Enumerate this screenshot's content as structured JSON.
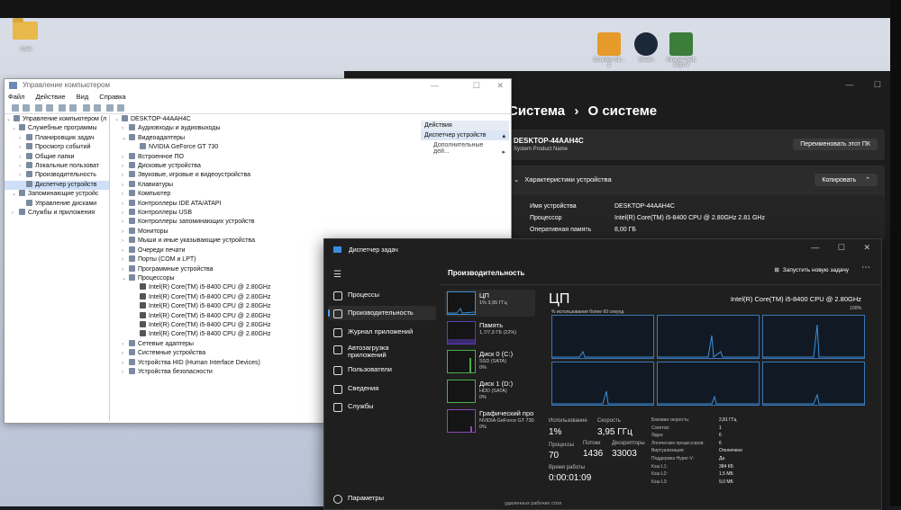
{
  "desktop": {
    "icons": [
      {
        "label": "User",
        "icon": "folder-icon"
      },
      {
        "label": "Counter-Str... 2",
        "icon": "cs2-icon"
      },
      {
        "label": "Steam",
        "icon": "steam-icon"
      },
      {
        "label": "Grand Theft Auto V",
        "icon": "gta5-icon"
      }
    ]
  },
  "devmgr": {
    "title": "Управление компьютером",
    "menu": [
      "Файл",
      "Действие",
      "Вид",
      "Справка"
    ],
    "left_tree": [
      "Управление компьютером (л",
      "Служебные программы",
      "Планировщик задач",
      "Просмотр событий",
      "Общие папки",
      "Локальные пользоват",
      "Производительность",
      "Диспетчер устройств",
      "Запоминающие устройс",
      "Управление дисками",
      "Службы и приложения"
    ],
    "device_tree": [
      "DESKTOP-44AAH4C",
      "Аудиовходы и аудиовыходы",
      "Видеоадаптеры",
      "NVIDIA GeForce GT 730",
      "Встроенное ПО",
      "Дисковые устройства",
      "Звуковые, игровые и видеоустройства",
      "Клавиатуры",
      "Компьютер",
      "Контроллеры IDE ATA/ATAPI",
      "Контроллеры USB",
      "Контроллеры запоминающих устройств",
      "Мониторы",
      "Мыши и иные указывающие устройства",
      "Очереди печати",
      "Порты (COM и LPT)",
      "Программные устройства",
      "Процессоры",
      "Intel(R) Core(TM) i5-8400 CPU @ 2.80GHz",
      "Intel(R) Core(TM) i5-8400 CPU @ 2.80GHz",
      "Intel(R) Core(TM) i5-8400 CPU @ 2.80GHz",
      "Intel(R) Core(TM) i5-8400 CPU @ 2.80GHz",
      "Intel(R) Core(TM) i5-8400 CPU @ 2.80GHz",
      "Intel(R) Core(TM) i5-8400 CPU @ 2.80GHz",
      "Сетевые адаптеры",
      "Системные устройства",
      "Устройства HID (Human Interface Devices)",
      "Устройства безопасности"
    ],
    "actions": {
      "header": "Действия",
      "selected": "Диспетчер устройств",
      "more": "Дополнительные дей..."
    }
  },
  "settings": {
    "breadcrumb_parent": "Система",
    "breadcrumb_sep": "›",
    "breadcrumb_current": "О системе",
    "device_name": "DESKTOP-44AAH4C",
    "product": "System Product Name",
    "rename_button": "Переименовать этот ПК",
    "specs_title": "Характеристики устройства",
    "copy_button": "Копировать",
    "spec_rows": [
      {
        "label": "Имя устройства",
        "value": "DESKTOP-44AAH4C"
      },
      {
        "label": "Процессор",
        "value": "Intel(R) Core(TM) i5-8400 CPU @ 2.80GHz   2.81 GHz"
      },
      {
        "label": "Оперативная память",
        "value": "8,00 ГБ"
      }
    ]
  },
  "taskmgr": {
    "title": "Диспетчер задач",
    "nav": [
      {
        "label": "Процессы",
        "icon": "processes-icon"
      },
      {
        "label": "Производительность",
        "icon": "performance-icon"
      },
      {
        "label": "Журнал приложений",
        "icon": "app-history-icon"
      },
      {
        "label": "Автозагрузка приложений",
        "icon": "startup-icon"
      },
      {
        "label": "Пользователи",
        "icon": "users-icon"
      },
      {
        "label": "Сведения",
        "icon": "details-icon"
      },
      {
        "label": "Службы",
        "icon": "services-icon"
      }
    ],
    "settings_label": "Параметры",
    "section_title": "Производительность",
    "run_task": "Запустить новую задачу",
    "devices": [
      {
        "name": "ЦП",
        "sub": "1% 3,95 ГГц"
      },
      {
        "name": "Память",
        "sub": "1,7/7,9 ГБ (22%)"
      },
      {
        "name": "Диск 0 (C:)",
        "sub": "SSD (SATA)\n0%"
      },
      {
        "name": "Диск 1 (D:)",
        "sub": "HDD (SATA)\n0%"
      },
      {
        "name": "Графический про",
        "sub": "NVIDIA GeForce GT 730\n0%"
      }
    ],
    "cpu": {
      "title": "ЦП",
      "model": "Intel(R) Core(TM) i5-8400 CPU @ 2.80GHz",
      "axis_label": "% использования более 60 секунд",
      "axis_max": "100%",
      "usage_label": "Использование",
      "usage": "1%",
      "speed_label": "Скорость",
      "speed": "3,95 ГГц",
      "processes_label": "Процессы",
      "processes": "70",
      "threads_label": "Потоки",
      "threads": "1436",
      "handles_label": "Дескрипторы",
      "handles": "33003",
      "uptime_label": "Время работы",
      "uptime": "0:00:01:09",
      "specs": [
        {
          "label": "Базовая скорость:",
          "value": "2,81 ГГц"
        },
        {
          "label": "Сокетов:",
          "value": "1"
        },
        {
          "label": "Ядра:",
          "value": "6"
        },
        {
          "label": "Логических процессоров:",
          "value": "6"
        },
        {
          "label": "Виртуализация:",
          "value": "Отключено"
        },
        {
          "label": "Поддержка Hyper-V:",
          "value": "Да"
        },
        {
          "label": "Кэш L1:",
          "value": "384 КБ"
        },
        {
          "label": "Кэш L2:",
          "value": "1,5 МБ"
        },
        {
          "label": "Кэш L3:",
          "value": "9,0 МБ"
        }
      ]
    }
  },
  "taskbar_fragment": "удаленных рабочих стол"
}
